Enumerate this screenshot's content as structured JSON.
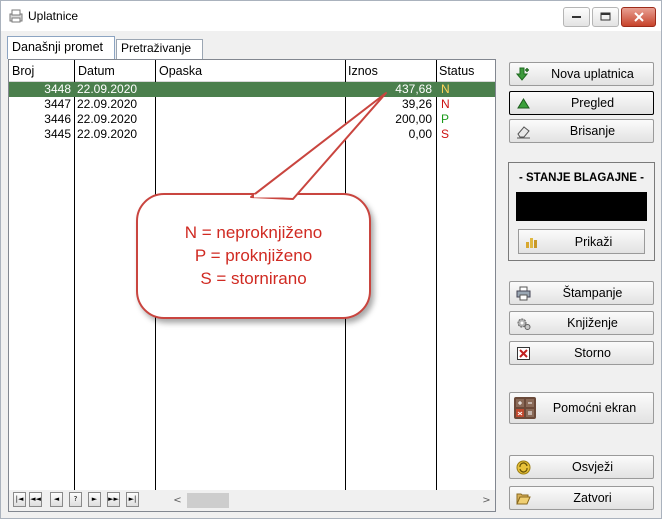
{
  "window": {
    "title": "Uplatnice",
    "icons": {
      "app": "uplatnice-app-icon",
      "minimize": "minimize-icon",
      "maximize": "maximize-icon",
      "close": "close-icon"
    }
  },
  "tabs": [
    {
      "label": "Današnji promet",
      "active": true
    },
    {
      "label": "Pretraživanje",
      "active": false
    }
  ],
  "grid": {
    "columns": [
      "Broj",
      "Datum",
      "Opaska",
      "Iznos",
      "Status"
    ],
    "rows": [
      {
        "broj": "3448",
        "datum": "22.09.2020",
        "opaska": "",
        "iznos": "437,68",
        "status": "N",
        "selected": true
      },
      {
        "broj": "3447",
        "datum": "22.09.2020",
        "opaska": "",
        "iznos": "39,26",
        "status": "N",
        "selected": false
      },
      {
        "broj": "3446",
        "datum": "22.09.2020",
        "opaska": "",
        "iznos": "200,00",
        "status": "P",
        "selected": false
      },
      {
        "broj": "3445",
        "datum": "22.09.2020",
        "opaska": "",
        "iznos": "0,00",
        "status": "S",
        "selected": false
      }
    ],
    "status_colors": {
      "N": "#cc1111",
      "P": "#1a9a1a",
      "S": "#cc1111",
      "N_selected": "#ffd45a"
    },
    "selection_color": "#4b7f4d",
    "navigator": [
      "|◄",
      "◄◄",
      "◄",
      "?",
      "►",
      "►►",
      "►|"
    ]
  },
  "actions": {
    "nova_uplatnica": "Nova uplatnica",
    "pregled": "Pregled",
    "brisanje": "Brisanje",
    "stanje_blagajne": "- STANJE BLAGAJNE -",
    "prikazi": "Prikaži",
    "stampanje": "Štampanje",
    "knjizenje": "Knjiženje",
    "storno": "Storno",
    "pomocni_ekran": "Pomoćni ekran",
    "osvjezi": "Osvježi",
    "zatvori": "Zatvori"
  },
  "callout": {
    "lines": [
      "N = neproknjiženo",
      "P = proknjiženo",
      "S = stornirano"
    ],
    "color": "#d02a22"
  }
}
